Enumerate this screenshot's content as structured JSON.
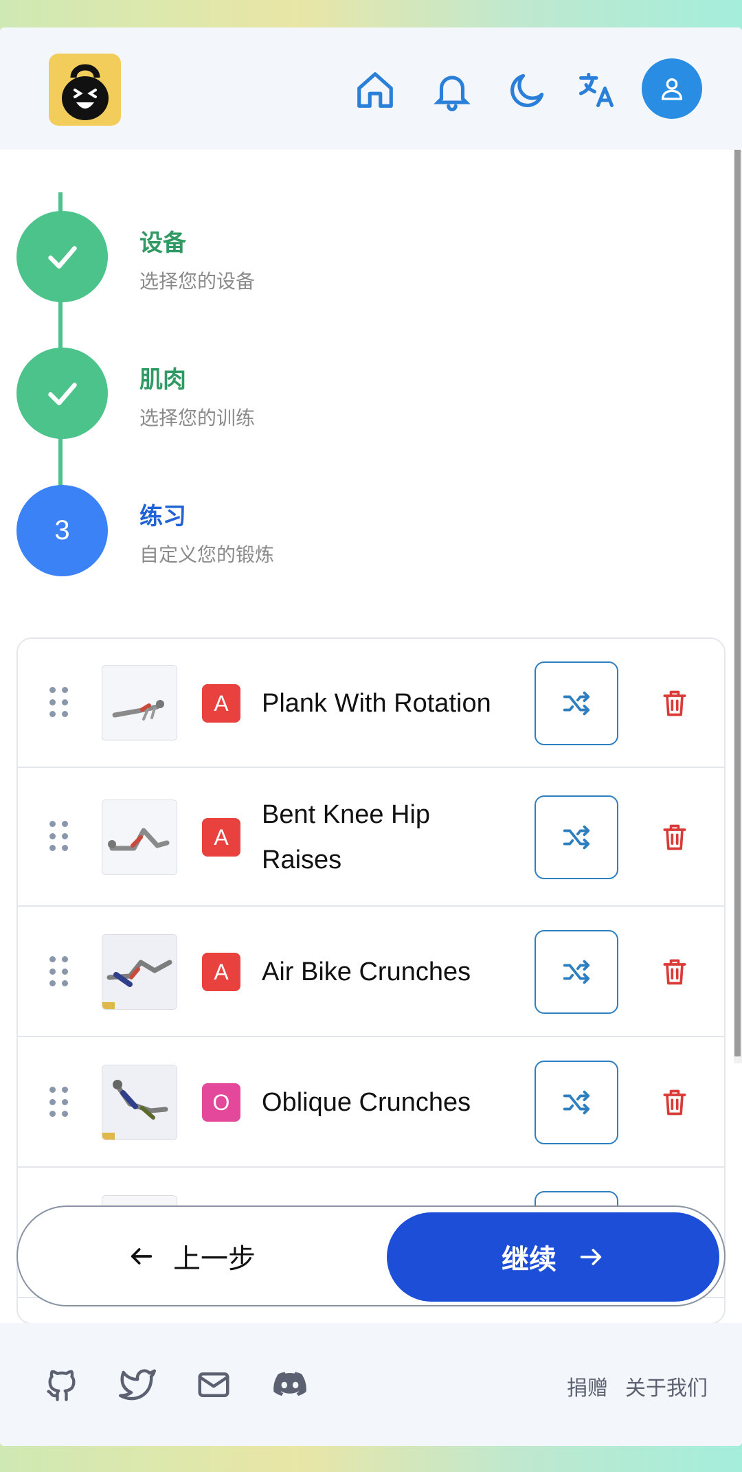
{
  "header": {
    "logo": "kettlebell-logo",
    "icons": [
      "home-icon",
      "bell-icon",
      "moon-icon",
      "translate-icon",
      "user-icon"
    ]
  },
  "stepper": {
    "steps": [
      {
        "title": "设备",
        "subtitle": "选择您的设备",
        "state": "done"
      },
      {
        "title": "肌肉",
        "subtitle": "选择您的训练",
        "state": "done"
      },
      {
        "title": "练习",
        "subtitle": "自定义您的锻炼",
        "state": "active",
        "number": "3"
      }
    ]
  },
  "exercises": [
    {
      "badge": "A",
      "badge_color": "#e8413e",
      "name": "Plank With Rotation"
    },
    {
      "badge": "A",
      "badge_color": "#e8413e",
      "name": "Bent Knee Hip Raises"
    },
    {
      "badge": "A",
      "badge_color": "#e8413e",
      "name": "Air Bike Crunches"
    },
    {
      "badge": "O",
      "badge_color": "#e4489a",
      "name": "Oblique Crunches"
    }
  ],
  "nav": {
    "prev_label": "上一步",
    "next_label": "继续"
  },
  "footer": {
    "icons": [
      "github-icon",
      "twitter-icon",
      "mail-icon",
      "discord-icon"
    ],
    "donate_label": "捐赠",
    "about_label": "关于我们"
  },
  "colors": {
    "accent": "#1d4ed8",
    "success": "#4cc38a",
    "danger": "#d93b37"
  }
}
